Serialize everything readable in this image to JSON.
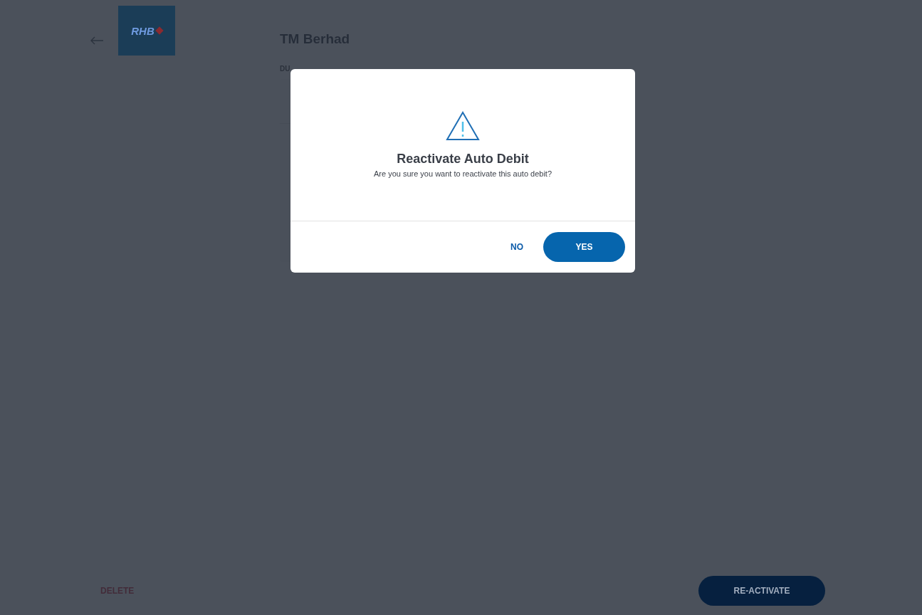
{
  "header": {
    "title": "TM Berhad",
    "logo": "RHB"
  },
  "section_label": "DU",
  "dialog": {
    "title": "Reactivate Auto Debit",
    "message": "Are you sure you want to reactivate this auto debit?",
    "buttons": [
      {
        "label": "NO",
        "kind": "text"
      },
      {
        "label": "YES",
        "kind": "primary"
      }
    ]
  },
  "footer": {
    "delete": "DELETE",
    "reactivate": "RE-ACTIVATE"
  }
}
